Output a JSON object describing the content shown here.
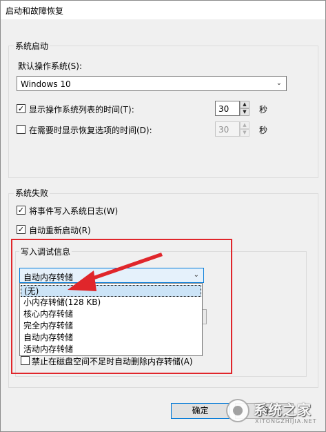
{
  "window": {
    "title": "启动和故障恢复"
  },
  "system_startup": {
    "legend": "系统启动",
    "default_os_label": "默认操作系统(S):",
    "default_os_value": "Windows 10",
    "show_os_list": {
      "label": "显示操作系统列表的时间(T):",
      "checked": true,
      "value": "30",
      "unit": "秒"
    },
    "show_recovery": {
      "label": "在需要时显示恢复选项的时间(D):",
      "checked": false,
      "value": "30",
      "unit": "秒"
    }
  },
  "system_failure": {
    "legend": "系统失败",
    "write_event_log": {
      "label": "将事件写入系统日志(W)",
      "checked": true
    },
    "auto_restart": {
      "label": "自动重新启动(R)",
      "checked": true
    },
    "debug_info": {
      "legend": "写入调试信息",
      "selected": "自动内存转储",
      "options": [
        "(无)",
        "小内存转储(128 KB)",
        "核心内存转储",
        "完全内存转储",
        "自动内存转储",
        "活动内存转储"
      ],
      "disable_auto_delete": {
        "label": "禁止在磁盘空间不足时自动删除内存转储(A)",
        "checked": false
      }
    }
  },
  "buttons": {
    "ok": "确定",
    "cancel": "取消"
  },
  "colors": {
    "highlight": "#cce4f7",
    "annotation_red": "#e0262b",
    "default_button_border": "#0078d7"
  },
  "watermark": {
    "text": "系统之家",
    "subtext": "XITONGZHIJIA.NET"
  }
}
